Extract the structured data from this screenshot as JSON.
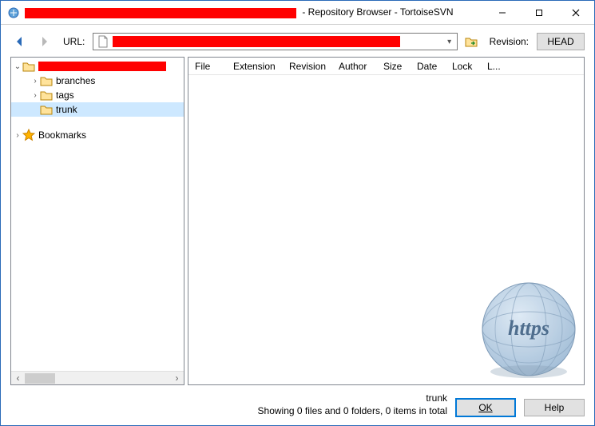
{
  "window": {
    "title_suffix": " - Repository Browser - TortoiseSVN"
  },
  "toolbar": {
    "url_label": "URL:",
    "revision_label": "Revision:",
    "head_label": "HEAD"
  },
  "tree": {
    "items": [
      {
        "kind": "root",
        "label": "",
        "expanded": true
      },
      {
        "kind": "folder",
        "label": "branches",
        "depth": 2,
        "expandable": true
      },
      {
        "kind": "folder",
        "label": "tags",
        "depth": 2,
        "expandable": true
      },
      {
        "kind": "folder",
        "label": "trunk",
        "depth": 2,
        "expandable": false,
        "selected": true
      },
      {
        "kind": "bookmarks",
        "label": "Bookmarks",
        "depth": 0,
        "expandable": true
      }
    ]
  },
  "list": {
    "columns": [
      "File",
      "Extension",
      "Revision",
      "Author",
      "Size",
      "Date",
      "Lock",
      "L..."
    ]
  },
  "footer": {
    "selection": "trunk",
    "status": "Showing 0 files and 0 folders, 0 items in total",
    "ok_label": "OK",
    "help_label": "Help"
  }
}
